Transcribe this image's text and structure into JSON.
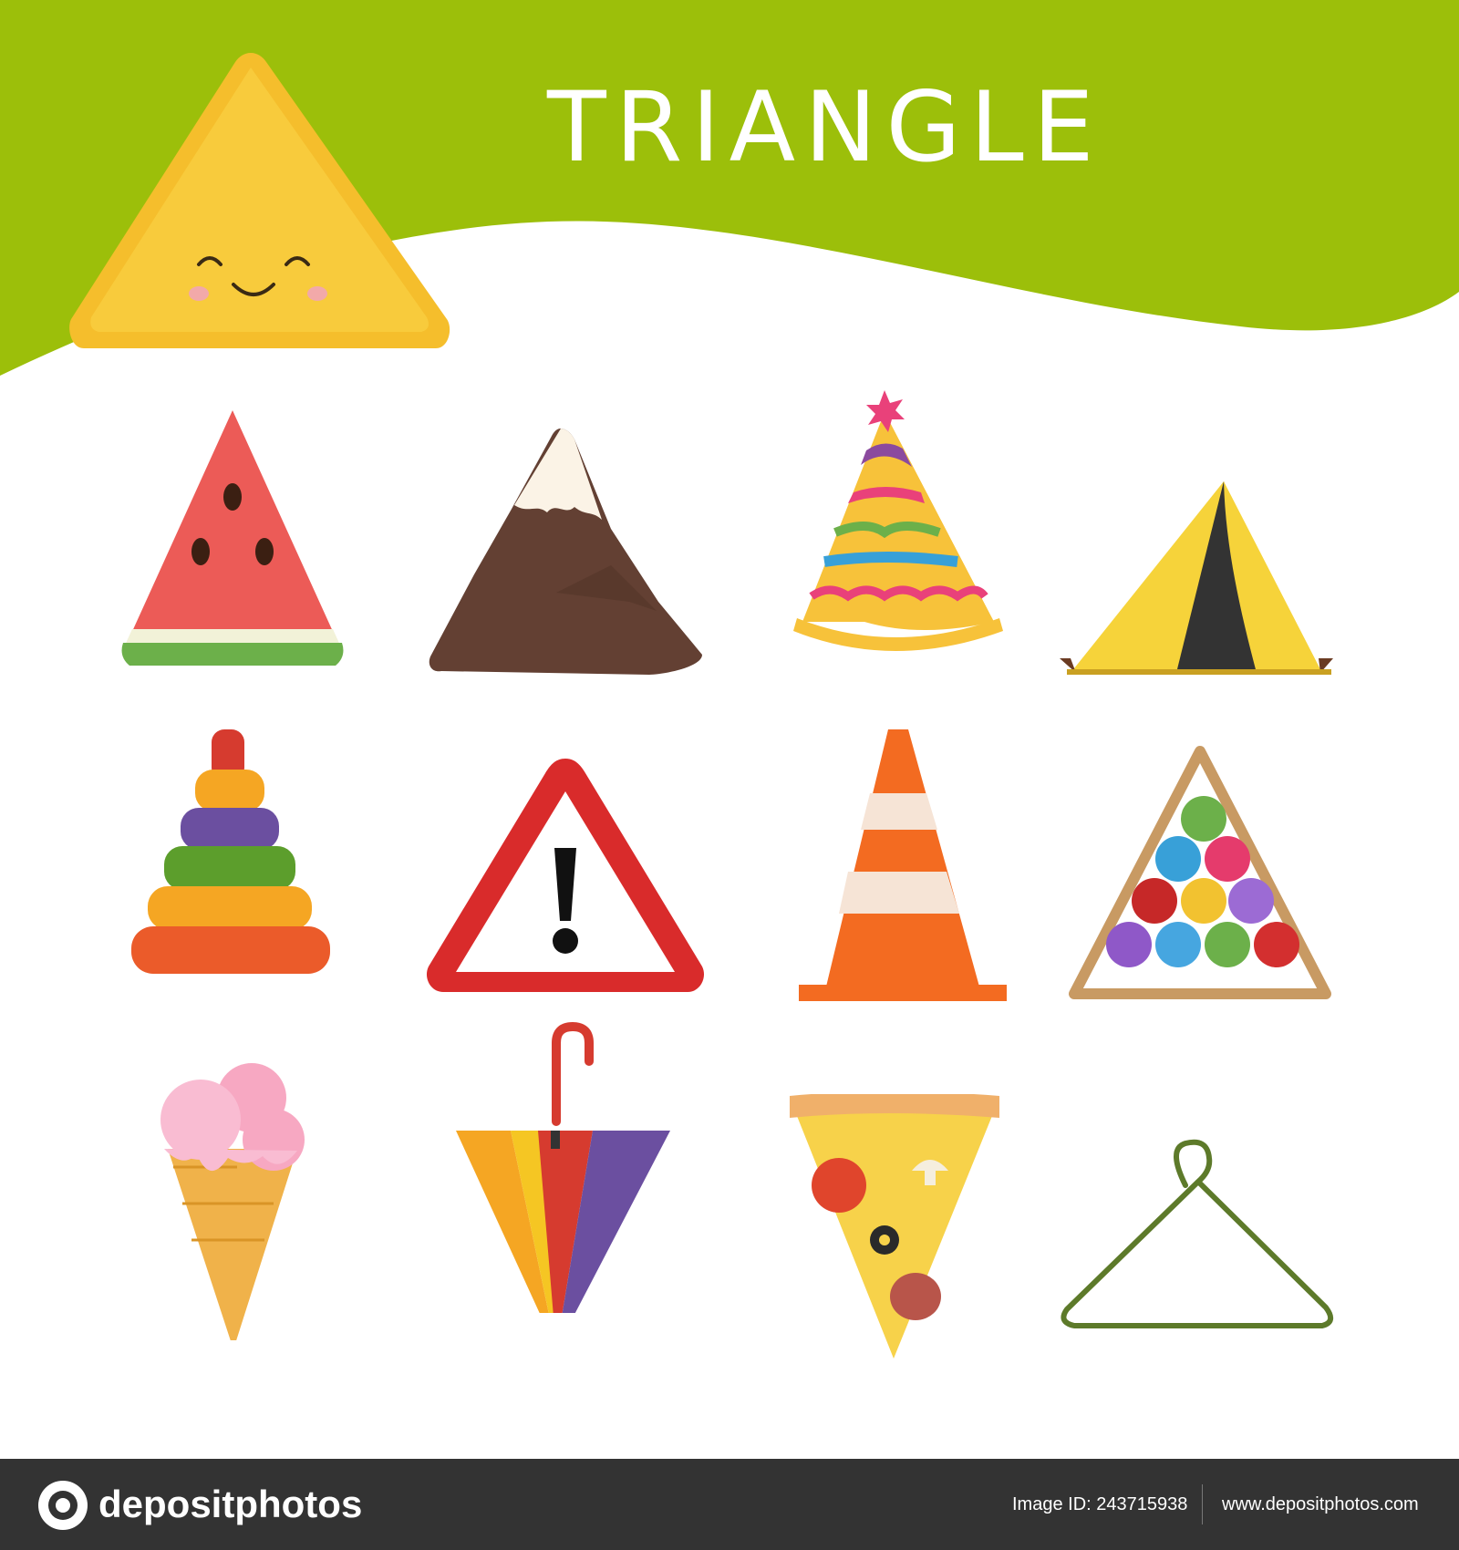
{
  "header": {
    "title": "TRIANGLE",
    "band_color": "#9cbf0a",
    "mascot": "smiling-yellow-triangle"
  },
  "items": [
    {
      "name": "watermelon-slice"
    },
    {
      "name": "snowy-mountain"
    },
    {
      "name": "party-hat"
    },
    {
      "name": "yellow-tent"
    },
    {
      "name": "stacking-ring-pyramid-toy"
    },
    {
      "name": "warning-sign"
    },
    {
      "name": "traffic-cone"
    },
    {
      "name": "billiard-ball-rack"
    },
    {
      "name": "ice-cream-cone"
    },
    {
      "name": "closed-umbrella"
    },
    {
      "name": "pizza-slice"
    },
    {
      "name": "clothes-hanger"
    }
  ],
  "footer": {
    "brand": "depositphotos",
    "image_id": "Image ID: 243715938",
    "url": "www.depositphotos.com"
  }
}
